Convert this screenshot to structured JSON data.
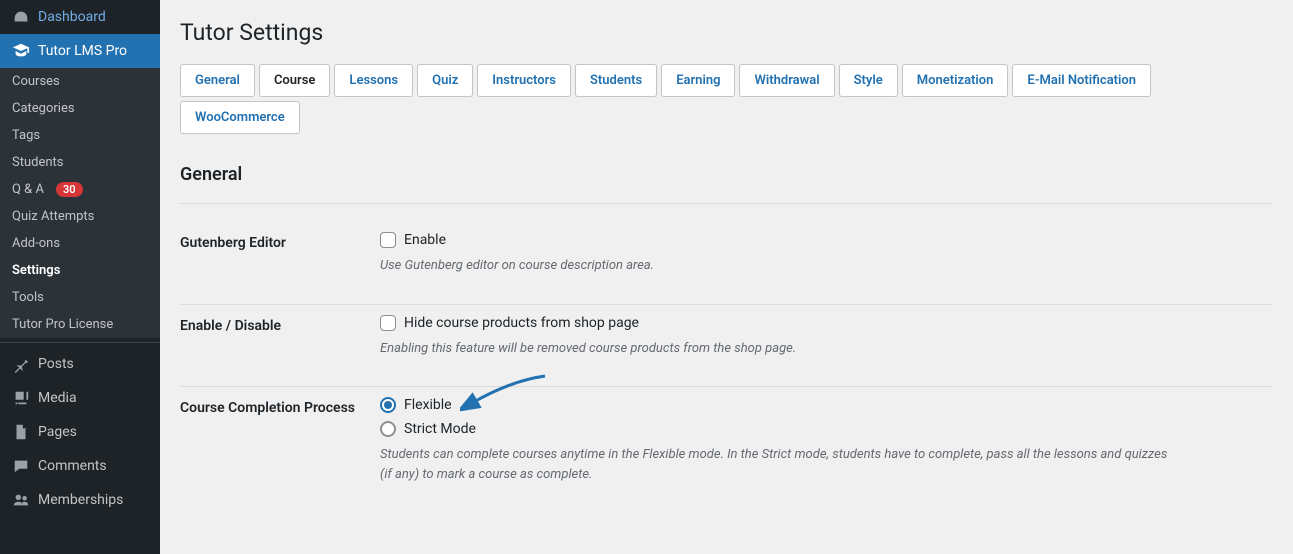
{
  "sidebar": {
    "dashboard": "Dashboard",
    "active_parent": "Tutor LMS Pro",
    "sub": {
      "courses": "Courses",
      "categories": "Categories",
      "tags": "Tags",
      "students": "Students",
      "qa": "Q & A",
      "qa_badge": "30",
      "quiz_attempts": "Quiz Attempts",
      "addons": "Add-ons",
      "settings": "Settings",
      "tools": "Tools",
      "license": "Tutor Pro License"
    },
    "posts": "Posts",
    "media": "Media",
    "pages": "Pages",
    "comments": "Comments",
    "memberships": "Memberships"
  },
  "page_title": "Tutor Settings",
  "tabs": {
    "general": "General",
    "course": "Course",
    "lessons": "Lessons",
    "quiz": "Quiz",
    "instructors": "Instructors",
    "students": "Students",
    "earning": "Earning",
    "withdrawal": "Withdrawal",
    "style": "Style",
    "monetization": "Monetization",
    "email": "E-Mail Notification",
    "woo": "WooCommerce"
  },
  "section_heading": "General",
  "gutenberg": {
    "label": "Gutenberg Editor",
    "enable": "Enable",
    "desc": "Use Gutenberg editor on course description area."
  },
  "enable_disable": {
    "label": "Enable / Disable",
    "hide": "Hide course products from shop page",
    "desc": "Enabling this feature will be removed course products from the shop page."
  },
  "completion": {
    "label": "Course Completion Process",
    "flexible": "Flexible",
    "strict": "Strict Mode",
    "desc": "Students can complete courses anytime in the Flexible mode. In the Strict mode, students have to complete, pass all the lessons and quizzes (if any) to mark a course as complete."
  }
}
